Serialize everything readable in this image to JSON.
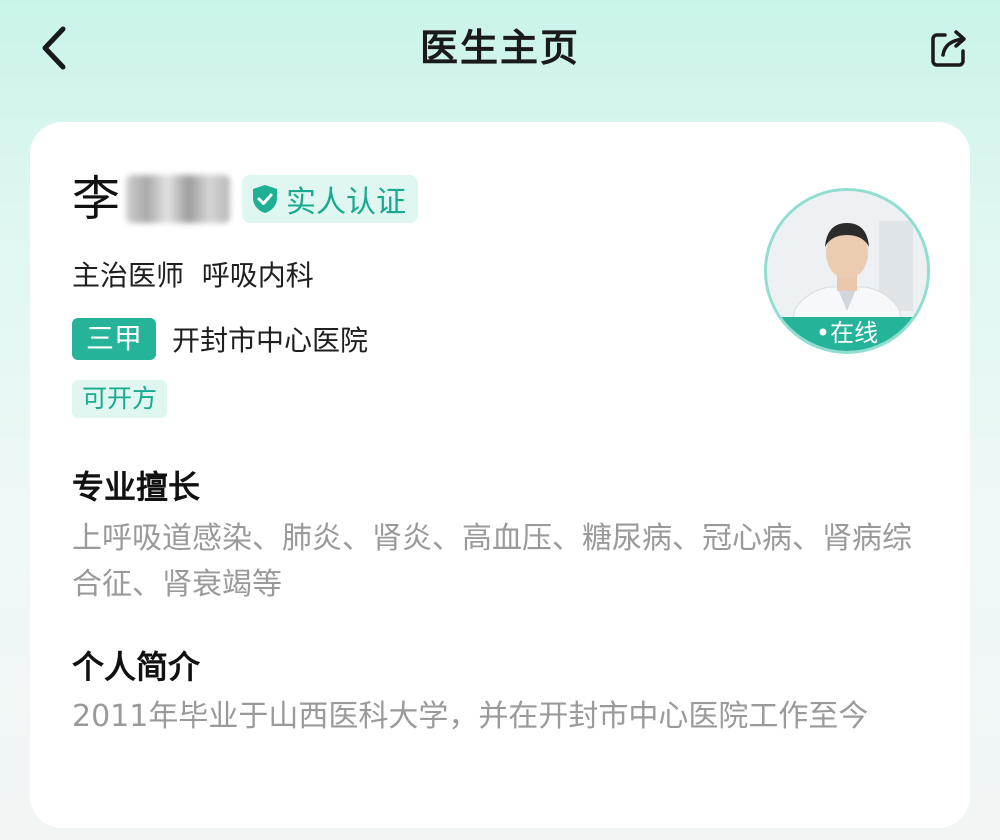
{
  "nav": {
    "title": "医生主页",
    "back_icon": "chevron-left-icon",
    "share_icon": "share-icon"
  },
  "doctor": {
    "surname": "李",
    "verified": "实人认证",
    "title_dept": "主治医师  呼吸内科",
    "hospital_level": "三甲",
    "hospital": "开封市中心医院",
    "prescription": "可开方",
    "status": "•在线"
  },
  "specialty": {
    "heading": "专业擅长",
    "text": "上呼吸道感染、肺炎、肾炎、高血压、糖尿病、冠心病、肾病综合征、肾衰竭等"
  },
  "intro": {
    "heading": "个人简介",
    "text": "2011年毕业于山西医科大学，并在开封市中心医院工作至今"
  },
  "colors": {
    "accent": "#25b39a",
    "accent_light": "#dff6f1",
    "muted_text": "#9a9a9a"
  }
}
